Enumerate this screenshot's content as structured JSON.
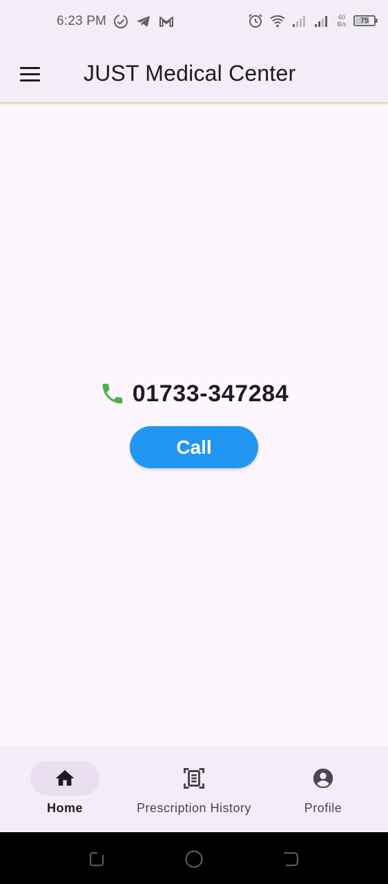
{
  "status_bar": {
    "time": "6:23 PM",
    "net_speed_value": "60",
    "net_speed_unit": "B/s",
    "battery": "75",
    "icons": [
      "check-sync-icon",
      "telegram-icon",
      "gmail-icon",
      "alarm-icon",
      "wifi-icon",
      "signal-icon",
      "signal-icon",
      "battery-icon"
    ]
  },
  "app_bar": {
    "menu_icon": "hamburger-menu-icon",
    "title": "JUST Medical Center"
  },
  "main": {
    "phone_icon": "phone-icon",
    "phone_number": "01733-347284",
    "call_label": "Call"
  },
  "bottom_nav": {
    "items": [
      {
        "label": "Home",
        "icon": "home-icon",
        "active": true
      },
      {
        "label": "Prescription History",
        "icon": "document-scan-icon",
        "active": false
      },
      {
        "label": "Profile",
        "icon": "account-circle-icon",
        "active": false
      }
    ]
  },
  "system_nav": {
    "buttons": [
      "recents-icon",
      "home-circle-icon",
      "back-icon"
    ]
  },
  "colors": {
    "bar_background": "#f2edf6",
    "content_background": "#fdf7fd",
    "call_button": "#2196f3",
    "phone_icon": "#4caf50",
    "nav_indicator": "#e9dff0"
  }
}
